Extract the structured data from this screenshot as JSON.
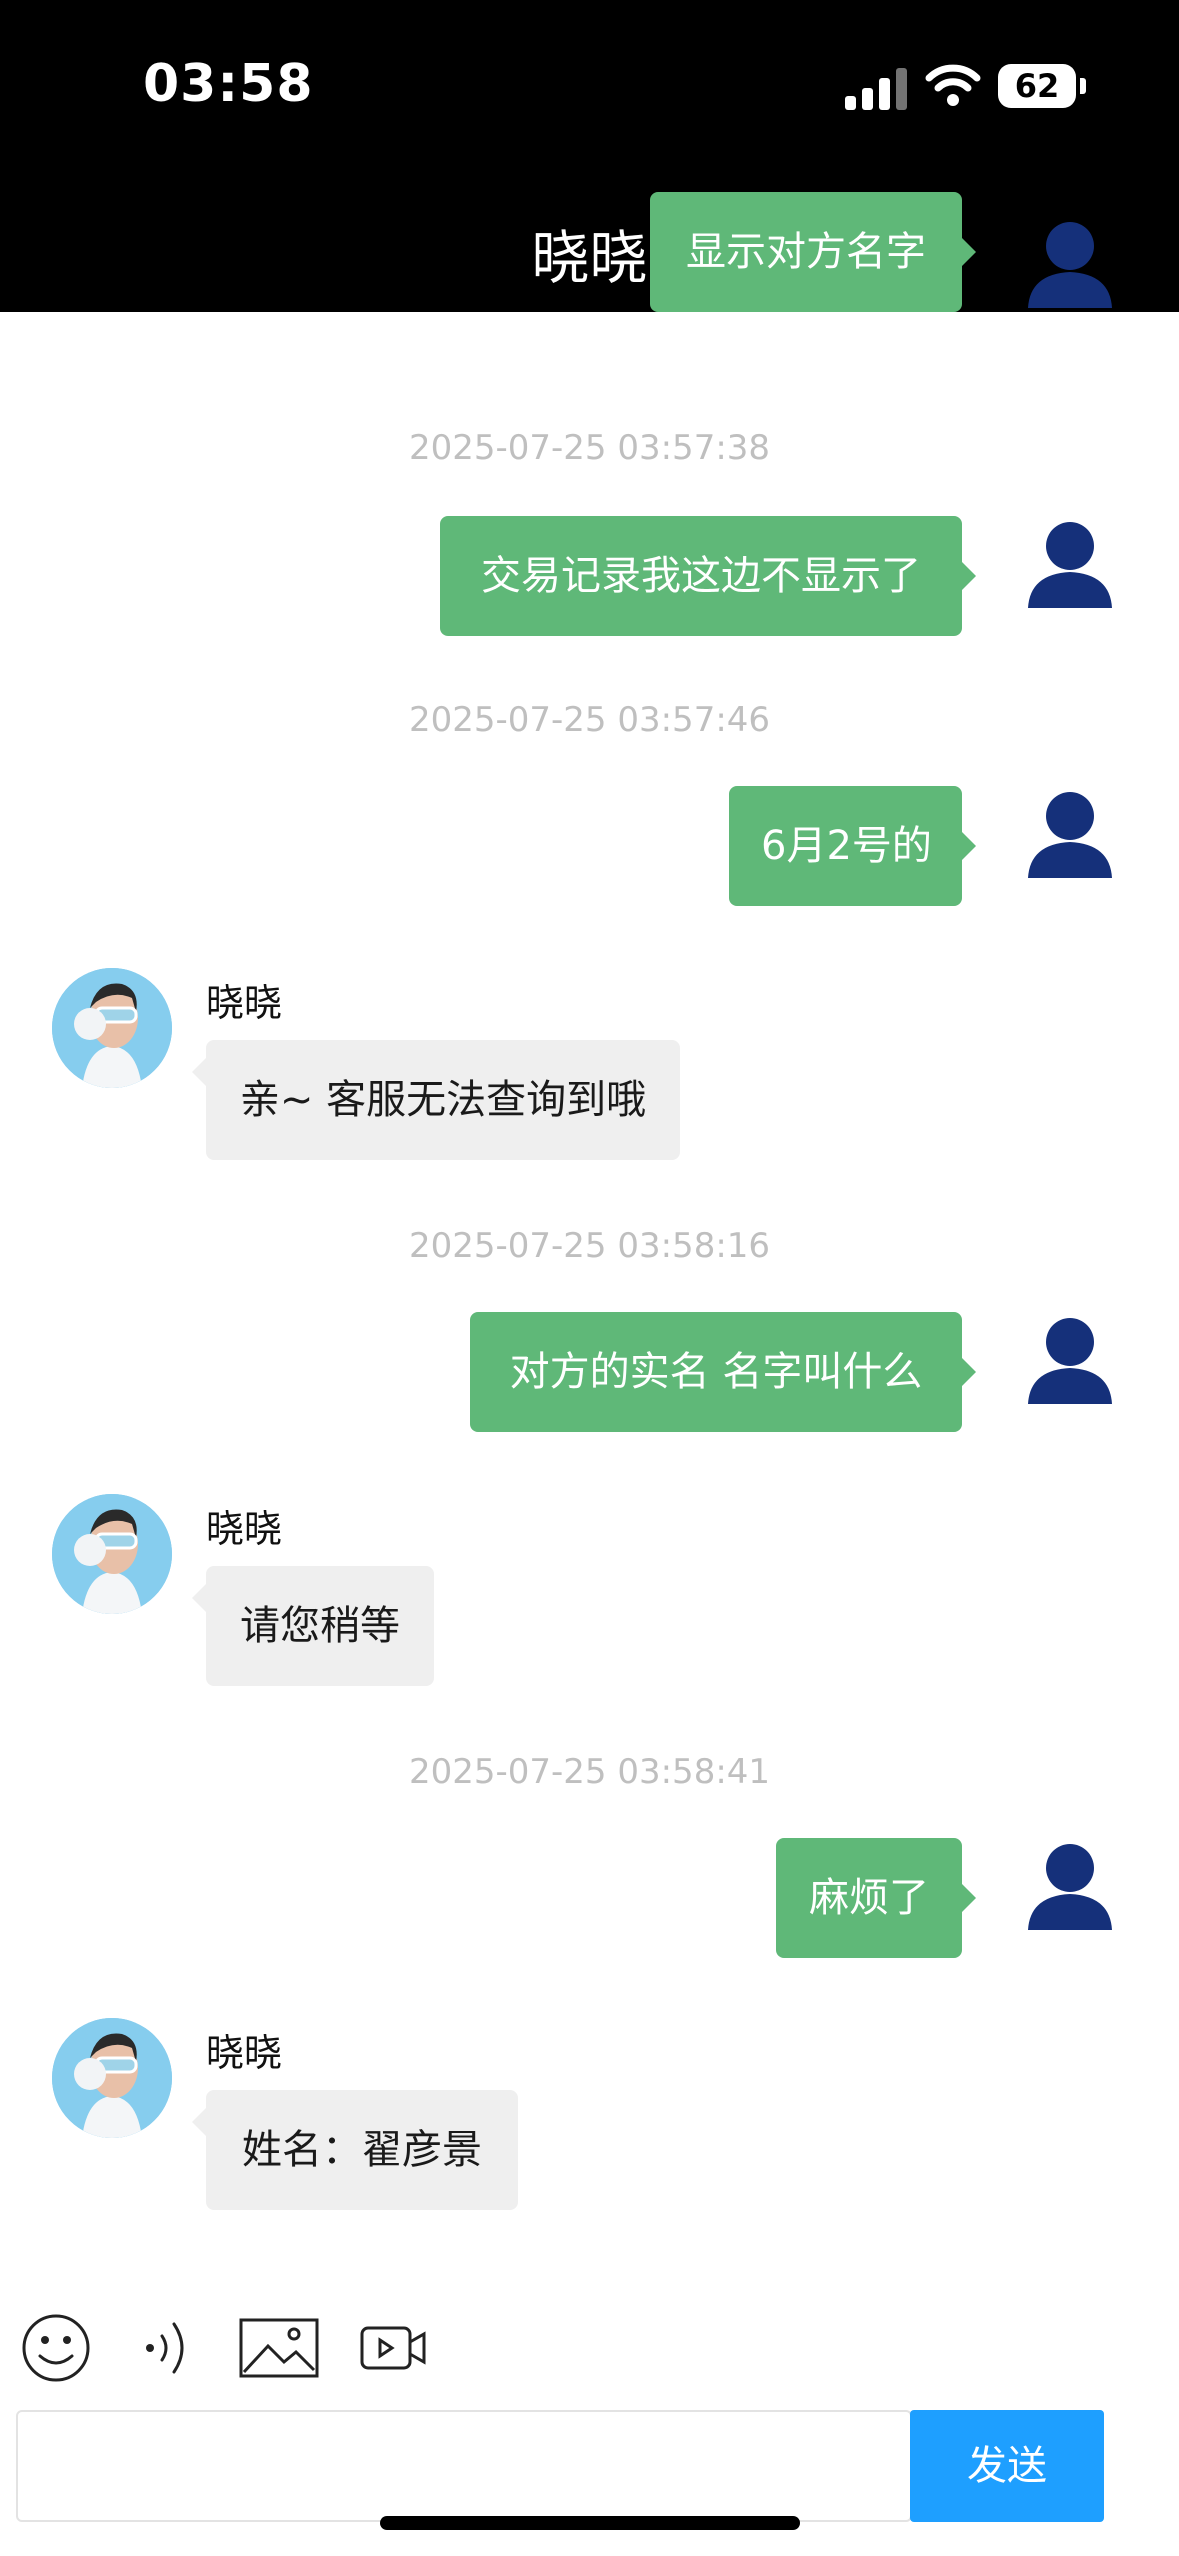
{
  "status_bar": {
    "time": "03:58",
    "battery": "62"
  },
  "header": {
    "title": "晓晓"
  },
  "top_partial_message": "显示对方名字",
  "messages": [
    {
      "type": "timestamp",
      "text": "2025-07-25 03:57:38"
    },
    {
      "type": "outgoing",
      "text": "交易记录我这边不显示了"
    },
    {
      "type": "timestamp",
      "text": "2025-07-25 03:57:46"
    },
    {
      "type": "outgoing",
      "text": "6月2号的"
    },
    {
      "type": "incoming",
      "sender": "晓晓",
      "text": "亲~ 客服无法查询到哦"
    },
    {
      "type": "timestamp",
      "text": "2025-07-25 03:58:16"
    },
    {
      "type": "outgoing",
      "text": "对方的实名 名字叫什么"
    },
    {
      "type": "incoming",
      "sender": "晓晓",
      "text": "请您稍等"
    },
    {
      "type": "timestamp",
      "text": "2025-07-25 03:58:41"
    },
    {
      "type": "outgoing",
      "text": "麻烦了"
    },
    {
      "type": "incoming",
      "sender": "晓晓",
      "text": "姓名：翟彦景"
    }
  ],
  "toolbar": {
    "icons": [
      "emoji-icon",
      "voice-icon",
      "image-icon",
      "video-icon"
    ]
  },
  "input": {
    "value": "",
    "send_label": "发送"
  },
  "colors": {
    "outgoing_bubble": "#5fb878",
    "incoming_bubble": "#efefef",
    "send_button": "#1e9fff",
    "header_bg": "#000000"
  }
}
